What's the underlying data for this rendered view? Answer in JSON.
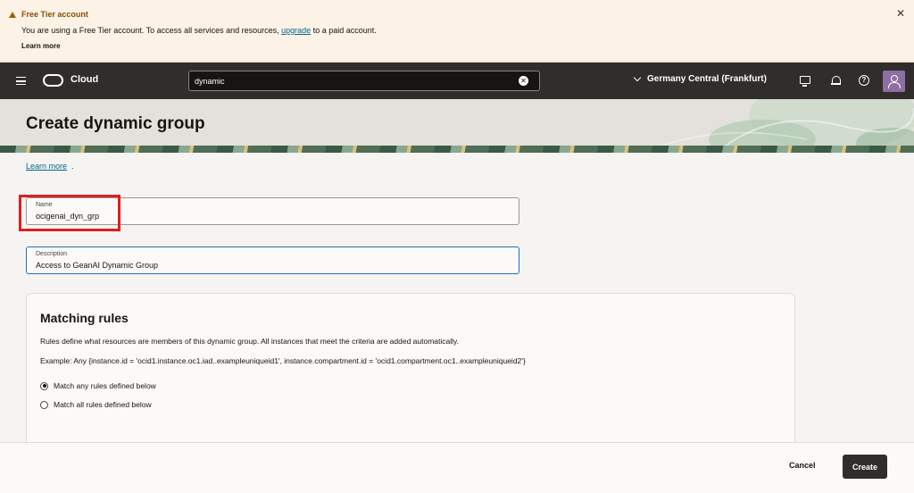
{
  "banner": {
    "title": "Free Tier account",
    "text_before": "You are using a Free Tier account. To access all services and resources, ",
    "link": "upgrade",
    "text_after": " to a paid account.",
    "learn_more": "Learn more",
    "close_icon": "close-icon"
  },
  "topnav": {
    "logo_text": "Cloud",
    "search_value": "dynamic",
    "region": "Germany Central (Frankfurt)",
    "icons": [
      "menu-icon",
      "cloud-shell-icon",
      "bell-icon",
      "help-icon",
      "user-avatar"
    ],
    "help_glyph": "?"
  },
  "page": {
    "title": "Create dynamic group",
    "learn_more": "Learn more",
    "learn_more_suffix": "."
  },
  "form": {
    "name_label": "Name",
    "name_value": "ocigenai_dyn_grp",
    "description_label": "Description",
    "description_value": "Access to GeanAI Dynamic Group"
  },
  "matching_rules": {
    "title": "Matching rules",
    "description": "Rules define what resources are members of this dynamic group. All instances that meet the criteria are added automatically.",
    "example": "Example: Any {instance.id = 'ocid1.instance.oc1.iad..exampleuniqueid1', instance.compartment.id = 'ocid1.compartment.oc1..exampleuniqueid2'}",
    "option_any": "Match any rules defined below",
    "option_all": "Match all rules defined below",
    "selected": "any"
  },
  "footer": {
    "cancel": "Cancel",
    "create": "Create"
  },
  "colors": {
    "nav_bg": "#312d2a",
    "banner_bg": "#fcf2e6",
    "highlight": "#e01d1d",
    "link": "#00688c"
  }
}
